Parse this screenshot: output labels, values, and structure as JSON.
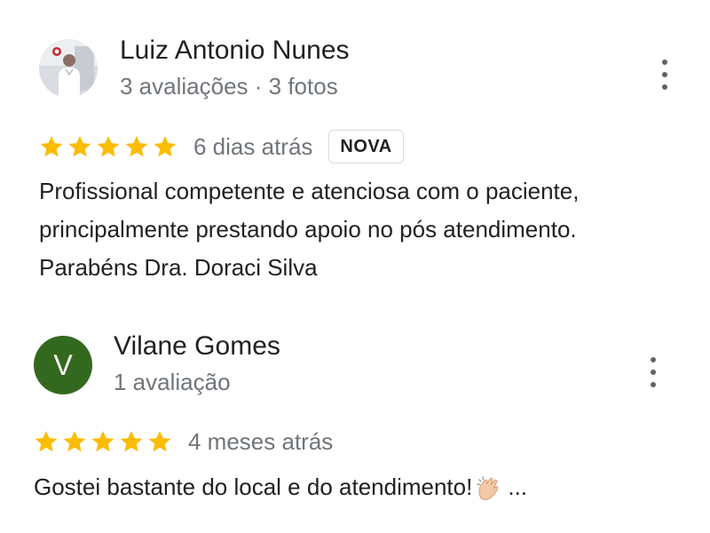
{
  "reviews": [
    {
      "author": "Luiz Antonio Nunes",
      "meta": "3 avaliações · 3 fotos",
      "rating": 5,
      "date": "6 dias atrás",
      "badge": "NOVA",
      "text_lines": [
        "Profissional competente e atenciosa com o paciente,",
        "principalmente prestando apoio no pós atendimento.",
        "Parabéns Dra. Doraci Silva"
      ],
      "avatar_type": "photo"
    },
    {
      "author": "Vilane Gomes",
      "meta": "1 avaliação",
      "rating": 5,
      "date": "4 meses atrás",
      "avatar_initial": "V",
      "avatar_color": "#33691e",
      "text": "Gostei bastante do local e do atendimento!",
      "emoji_icon": "clapping-hands-icon",
      "more_label": "..."
    }
  ],
  "colors": {
    "star": "#fbbc04",
    "secondary_text": "#70757a"
  }
}
